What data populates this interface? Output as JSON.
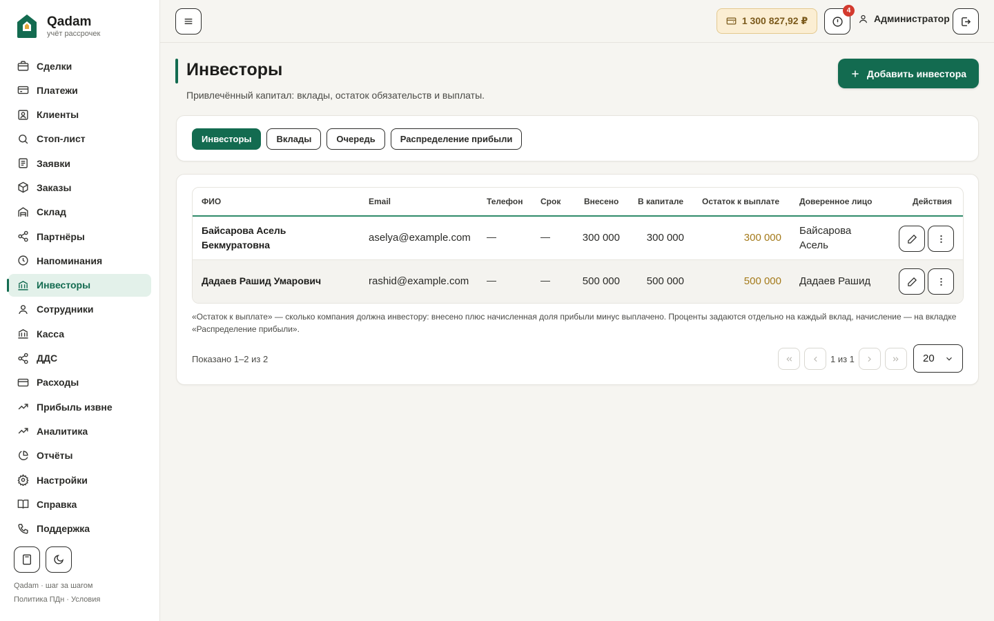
{
  "brand": {
    "name": "Qadam",
    "subtitle": "учёт рассрочек"
  },
  "nav": [
    {
      "label": "Сделки",
      "icon": "briefcase-icon"
    },
    {
      "label": "Платежи",
      "icon": "credit-card-icon"
    },
    {
      "label": "Клиенты",
      "icon": "contact-icon"
    },
    {
      "label": "Стоп-лист",
      "icon": "search-icon"
    },
    {
      "label": "Заявки",
      "icon": "document-icon"
    },
    {
      "label": "Заказы",
      "icon": "box-icon"
    },
    {
      "label": "Склад",
      "icon": "warehouse-icon"
    },
    {
      "label": "Партнёры",
      "icon": "share-icon"
    },
    {
      "label": "Напоминания",
      "icon": "clock-icon"
    },
    {
      "label": "Инвесторы",
      "icon": "bank-icon",
      "active": true
    },
    {
      "label": "Сотрудники",
      "icon": "user-icon"
    },
    {
      "label": "Касса",
      "icon": "bank-icon"
    },
    {
      "label": "ДДС",
      "icon": "share-icon"
    },
    {
      "label": "Расходы",
      "icon": "wallet-icon"
    },
    {
      "label": "Прибыль извне",
      "icon": "trend-up-icon"
    },
    {
      "label": "Аналитика",
      "icon": "trend-up-icon"
    },
    {
      "label": "Отчёты",
      "icon": "pie-chart-icon"
    },
    {
      "label": "Настройки",
      "icon": "gear-icon"
    },
    {
      "label": "Справка",
      "icon": "book-icon"
    },
    {
      "label": "Поддержка",
      "icon": "phone-icon"
    }
  ],
  "side_footer": {
    "line1": "Qadam · шаг за шагом",
    "line2": "Политика ПДн · Условия"
  },
  "topbar": {
    "balance": "1 300 827,92 ₽",
    "alerts_count": "4",
    "user": "Администратор"
  },
  "page": {
    "title": "Инвесторы",
    "subtitle": "Привлечённый капитал: вклады, остаток обязательств и выплаты.",
    "add_button": "Добавить инвестора"
  },
  "tabs": [
    "Инвесторы",
    "Вклады",
    "Очередь",
    "Распределение прибыли"
  ],
  "table": {
    "columns": [
      "ФИО",
      "Email",
      "Телефон",
      "Срок",
      "Внесено",
      "В капитале",
      "Остаток к выплате",
      "Доверенное лицо",
      "Действия"
    ],
    "rows": [
      {
        "name": "Байсарова Асель Бекмуратовна",
        "email": "aselya@example.com",
        "phone": "—",
        "term": "—",
        "paid_in": "300 000",
        "in_capital": "300 000",
        "to_pay": "300 000",
        "proxy": "Байсарова Асель"
      },
      {
        "name": "Дадаев Рашид Умарович",
        "email": "rashid@example.com",
        "phone": "—",
        "term": "—",
        "paid_in": "500 000",
        "in_capital": "500 000",
        "to_pay": "500 000",
        "proxy": "Дадаев Рашид"
      }
    ]
  },
  "note": "«Остаток к выплате» — сколько компания должна инвестору: внесено плюс начисленная доля прибыли минус выплачено. Проценты задаются отдельно на каждый вклад, начисление — на вкладке «Распределение прибыли».",
  "pagination": {
    "shown": "Показано 1–2 из 2",
    "pages": "1 из 1",
    "per_page": "20"
  },
  "colors": {
    "primary": "#136b50",
    "accent_amber": "#a47a1a",
    "badge": "#d33a2e"
  }
}
